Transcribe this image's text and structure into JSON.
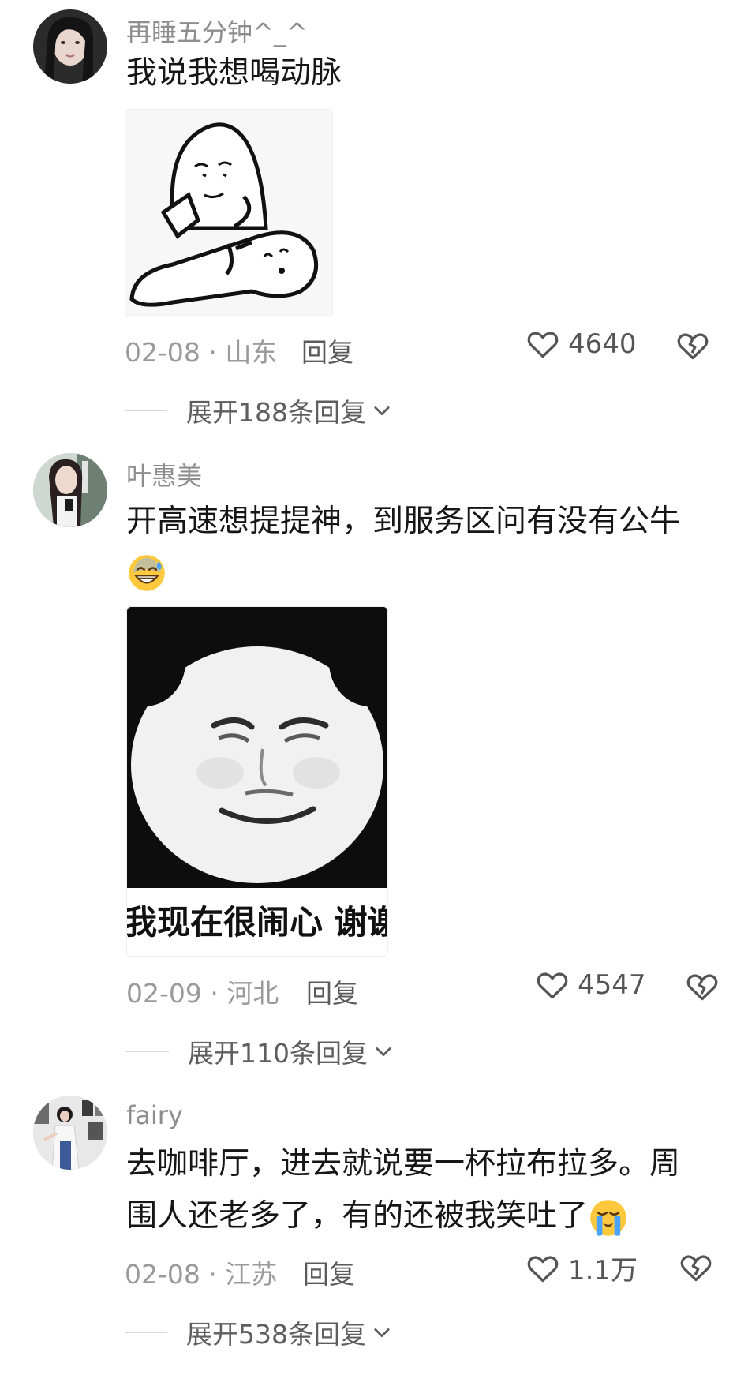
{
  "comments": [
    {
      "username": "再睡五分钟^_^",
      "text": "我说我想喝动脉",
      "sticker": {
        "kind": "meme-drawing"
      },
      "date_location": "02-08 · 山东",
      "reply_label": "回复",
      "likes": "4640",
      "expand_label": "展开188条回复"
    },
    {
      "username": "叶惠美",
      "text": "开高速想提提神，到服务区问有没有公牛",
      "emoji": "grinning-sweat-emoji",
      "sticker": {
        "kind": "panda-meme",
        "caption": "我现在很闹心 谢谢"
      },
      "date_location": "02-09 · 河北",
      "reply_label": "回复",
      "likes": "4547",
      "expand_label": "展开110条回复"
    },
    {
      "username": "fairy",
      "text_line1": "去咖啡厅，进去就说要一杯拉布拉多。周",
      "text_line2": "围人还老多了，有的还被我笑吐了",
      "emoji": "loudly-crying-emoji",
      "date_location": "02-08 · 江苏",
      "reply_label": "回复",
      "likes": "1.1万",
      "expand_label": "展开538条回复"
    }
  ],
  "icons": {
    "like": "heart-outline-icon",
    "dislike": "broken-heart-icon",
    "expand": "chevron-down-icon"
  },
  "colors": {
    "username": "#8e8e8e",
    "text": "#161616",
    "meta": "#9a9a9a"
  }
}
